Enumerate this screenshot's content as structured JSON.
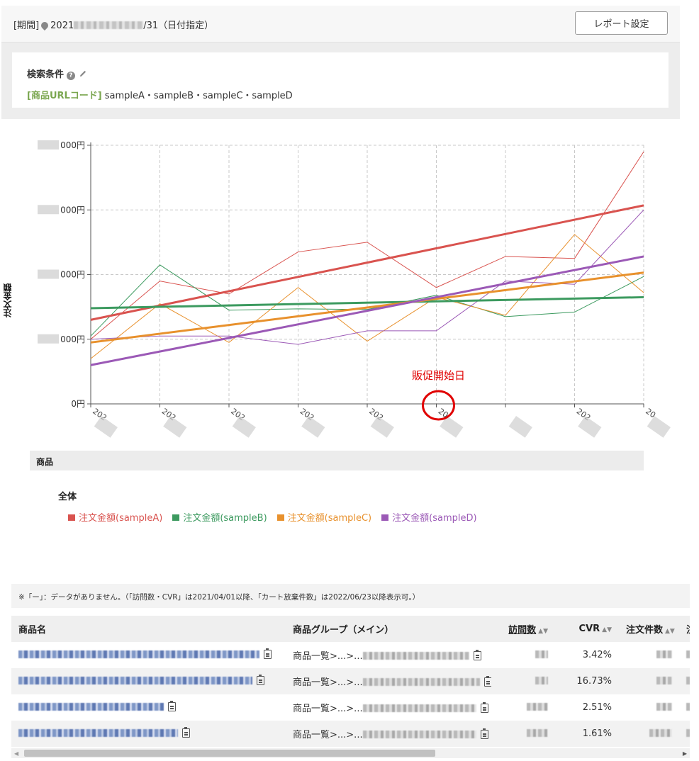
{
  "header": {
    "period_prefix": "[期間]",
    "period_start": "2021",
    "period_end": "/31（日付指定）",
    "report_button": "レポート設定"
  },
  "conditions": {
    "title": "検索条件",
    "key": "[商品URLコード]",
    "value": "sampleA・sampleB・sampleC・sampleD"
  },
  "chart_data": {
    "type": "line",
    "ylabel": "注文金額",
    "y_ticks": [
      "000円",
      "000円",
      "000円",
      "000円",
      "0円"
    ],
    "x_tick_labels": [
      "202",
      "202",
      "202",
      "202",
      "202",
      "20",
      "",
      "202",
      "20"
    ],
    "annotation": "販促開始日",
    "grid": true,
    "series": [
      {
        "name": "注文金額(sampleA)",
        "color": "#d9534f",
        "values": [
          1.0,
          1.9,
          1.7,
          2.35,
          2.5,
          1.8,
          2.28,
          2.25,
          3.9
        ]
      },
      {
        "name": "注文金額(sampleB)",
        "color": "#3c9a5f",
        "values": [
          1.05,
          2.15,
          1.45,
          1.47,
          1.46,
          1.68,
          1.35,
          1.42,
          1.97
        ]
      },
      {
        "name": "注文金額(sampleC)",
        "color": "#e8912d",
        "values": [
          0.7,
          1.55,
          0.95,
          1.8,
          0.97,
          1.65,
          1.37,
          2.62,
          1.72
        ]
      },
      {
        "name": "注文金額(sampleD)",
        "color": "#9b59b6",
        "values": [
          1.0,
          1.05,
          1.05,
          0.92,
          1.13,
          1.13,
          1.9,
          1.85,
          3.0
        ]
      }
    ],
    "trends": [
      {
        "name": "注文金額(sampleA)",
        "color": "#d9534f",
        "start": 1.3,
        "end": 3.07
      },
      {
        "name": "注文金額(sampleB)",
        "color": "#3c9a5f",
        "start": 1.48,
        "end": 1.65
      },
      {
        "name": "注文金額(sampleC)",
        "color": "#e8912d",
        "start": 0.95,
        "end": 2.03
      },
      {
        "name": "注文金額(sampleD)",
        "color": "#9b59b6",
        "start": 0.6,
        "end": 2.28
      }
    ]
  },
  "section_label": "商品",
  "legend": {
    "title": "全体",
    "items": [
      {
        "label": "注文金額(sampleA)",
        "color": "#d9534f"
      },
      {
        "label": "注文金額(sampleB)",
        "color": "#3c9a5f"
      },
      {
        "label": "注文金額(sampleC)",
        "color": "#e8912d"
      },
      {
        "label": "注文金額(sampleD)",
        "color": "#9b59b6"
      }
    ]
  },
  "note": "※「ー」：データがありません。（「訪問数・CVR」は2021/04/01以降、「カート放棄件数」は2022/06/23以降表示可。）",
  "table": {
    "headers": [
      "商品名",
      "商品グループ（メイン）",
      "訪問数",
      "CVR",
      "注文件数",
      "注文金"
    ],
    "rows": [
      {
        "group": "商品一覧>...>...",
        "cvr": "3.42%"
      },
      {
        "group": "商品一覧>...>...",
        "cvr": "16.73%"
      },
      {
        "group": "商品一覧>...>...",
        "cvr": "2.51%"
      },
      {
        "group": "商品一覧>...>...",
        "cvr": "1.61%"
      }
    ]
  }
}
